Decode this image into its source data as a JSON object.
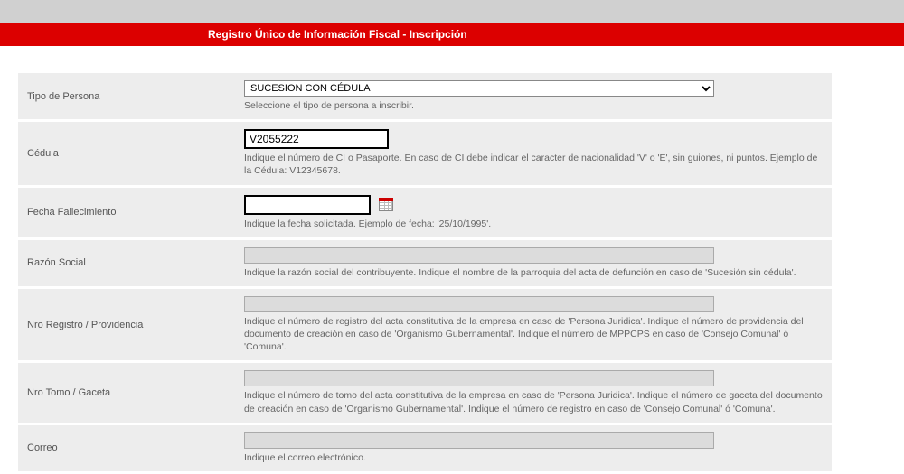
{
  "header": {
    "title": "Registro Único de Información Fiscal - Inscripción"
  },
  "fields": {
    "tipoPersona": {
      "label": "Tipo de Persona",
      "selected": "SUCESION CON CÉDULA",
      "hint": "Seleccione el tipo de persona a inscribir."
    },
    "cedula": {
      "label": "Cédula",
      "value": "V2055222",
      "hint": "Indique el número de CI o Pasaporte. En caso de CI debe indicar el caracter de nacionalidad 'V' o 'E', sin guiones, ni puntos. Ejemplo de la Cédula: V12345678."
    },
    "fechaFallecimiento": {
      "label": "Fecha Fallecimiento",
      "value": "",
      "hint": "Indique la fecha solicitada. Ejemplo de fecha: '25/10/1995'."
    },
    "razonSocial": {
      "label": "Razón Social",
      "value": "",
      "hint": "Indique la razón social del contribuyente. Indique el nombre de la parroquia del acta de defunción en caso de 'Sucesión sin cédula'."
    },
    "nroRegistro": {
      "label": "Nro Registro / Providencia",
      "value": "",
      "hint": "Indique el número de registro del acta constitutiva de la empresa en caso de 'Persona Juridica'. Indique el número de providencia del documento de creación en caso de 'Organismo Gubernamental'. Indique el número de MPPCPS en caso de 'Consejo Comunal' ó 'Comuna'."
    },
    "nroTomo": {
      "label": "Nro Tomo / Gaceta",
      "value": "",
      "hint": "Indique el número de tomo del acta constitutiva de la empresa en caso de 'Persona Juridica'. Indique el número de gaceta del documento de creación en caso de 'Organismo Gubernamental'. Indique el número de registro en caso de 'Consejo Comunal' ó 'Comuna'."
    },
    "correo": {
      "label": "Correo",
      "value": "",
      "hint": "Indique el correo electrónico."
    }
  }
}
